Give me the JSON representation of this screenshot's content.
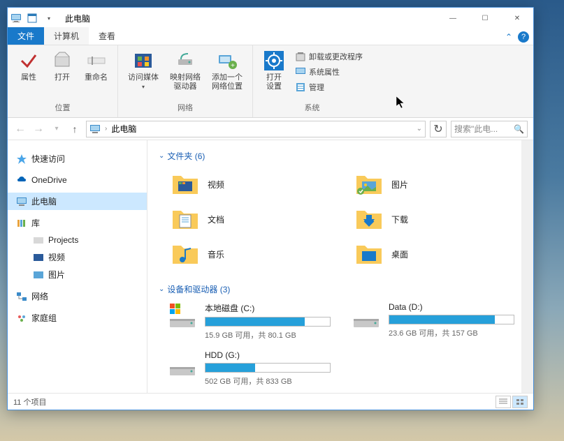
{
  "window": {
    "title": "此电脑"
  },
  "tabs": {
    "file": "文件",
    "computer": "计算机",
    "view": "查看"
  },
  "ribbon": {
    "group_location": "位置",
    "group_network": "网络",
    "group_system": "系统",
    "properties": "属性",
    "open": "打开",
    "rename": "重命名",
    "access_media": "访问媒体",
    "map_drive": "映射网络\n驱动器",
    "add_network": "添加一个\n网络位置",
    "open_settings": "打开\n设置",
    "uninstall": "卸载或更改程序",
    "sys_props": "系统属性",
    "manage": "管理"
  },
  "address": {
    "location": "此电脑"
  },
  "search": {
    "placeholder": "搜索\"此电..."
  },
  "sidebar": {
    "quick": "快速访问",
    "onedrive": "OneDrive",
    "thispc": "此电脑",
    "library": "库",
    "projects": "Projects",
    "videos": "视频",
    "pictures": "图片",
    "network": "网络",
    "homegroup": "家庭组"
  },
  "sections": {
    "folders": "文件夹 (6)",
    "drives": "设备和驱动器 (3)"
  },
  "folders": {
    "videos": "视频",
    "pictures": "图片",
    "documents": "文档",
    "downloads": "下载",
    "music": "音乐",
    "desktop": "桌面"
  },
  "drives": [
    {
      "name": "本地磁盘 (C:)",
      "free": "15.9 GB 可用，共 80.1 GB",
      "fill": 80
    },
    {
      "name": "Data (D:)",
      "free": "23.6 GB 可用，共 157 GB",
      "fill": 85
    },
    {
      "name": "HDD (G:)",
      "free": "502 GB 可用，共 833 GB",
      "fill": 40
    }
  ],
  "status": {
    "items": "11 个项目"
  }
}
